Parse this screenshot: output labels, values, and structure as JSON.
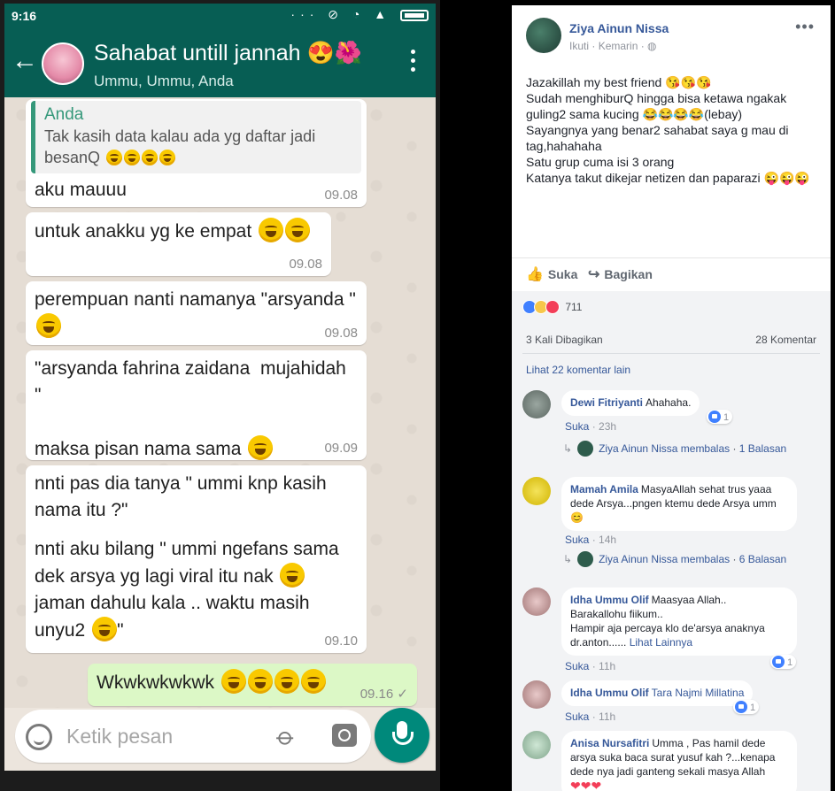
{
  "whatsapp": {
    "status_time": "9:16",
    "status_icons": "··· ⊘ ◔ ▲",
    "back_glyph": "←",
    "chat_title": "Sahabat untill jannah 😍🌺",
    "chat_subtitle": "Ummu, Ummu, Anda",
    "messages": [
      {
        "quote_author": "Anda",
        "quote_text": "Tak kasih data kalau ada yg daftar jadi besanQ",
        "text": "aku mauuu",
        "time": "09.08"
      },
      {
        "text": "untuk anakku yg ke empat",
        "time": "09.08"
      },
      {
        "text": "perempuan nanti namanya \"arsyanda \"",
        "time": "09.08"
      },
      {
        "text": "\"arsyanda fahrina zaidana  mujahidah \"\n\nmaksa pisan nama sama",
        "time": "09.09"
      },
      {
        "text1": "nnti pas dia tanya \" ummi knp kasih nama itu ?\"",
        "text2": "nnti aku bilang \" ummi ngefans sama dek arsya yg lagi viral itu nak",
        "text3": "jaman dahulu kala .. waktu masih unyu2",
        "text4": "\"",
        "time": "09.10"
      },
      {
        "text": "Wkwkwkwkwk",
        "time": "09.16",
        "tick": "✓",
        "outgoing": true
      }
    ],
    "composer_placeholder": "Ketik pesan"
  },
  "facebook": {
    "author": "Ziya Ainun Nissa",
    "follow": "Ikuti",
    "time": "Kemarin",
    "privacy_icon": "globe-icon",
    "more": "•••",
    "post_lines": [
      "Jazakillah my best friend 😘😘😘",
      "Sudah menghiburQ hingga bisa ketawa ngakak guling2 sama kucing 😂😂😂😂(lebay)",
      "Sayangnya yang benar2 sahabat saya g mau di tag,hahahaha",
      "Satu grup cuma isi 3 orang",
      "Katanya takut dikejar netizen dan paparazi 😜😜😜"
    ],
    "like_label": "Suka",
    "share_label": "Bagikan",
    "reaction_count": "711",
    "shares_text": "3 Kali Dibagikan",
    "comments_text": "28 Komentar",
    "more_comments": "Lihat 22 komentar lain",
    "comments": [
      {
        "name": "Dewi Fitriyanti",
        "text": "Ahahaha.",
        "likes": "1",
        "action": "Suka",
        "age": "23h",
        "reply_name": "Ziya Ainun Nissa membalas",
        "reply_count": "1 Balasan"
      },
      {
        "name": "Mamah Amila",
        "text": "MasyaAllah sehat trus yaaa dede Arsya...pngen ktemu dede Arsya umm😊",
        "action": "Suka",
        "age": "14h",
        "reply_name": "Ziya Ainun Nissa membalas",
        "reply_count": "6 Balasan"
      },
      {
        "name": "Idha Ummu Olif",
        "text1": "Maasyaa Allah..",
        "text2": "Barakallohu fiikum..",
        "text3": "Hampir aja percaya klo de'arsya anaknya dr.anton......",
        "see_more": "Lihat Lainnya",
        "likes": "1",
        "action": "Suka",
        "age": "11h"
      },
      {
        "name": "Idha Ummu Olif",
        "text": "Tara Najmi Millatina",
        "likes": "1",
        "action": "Suka",
        "age": "11h"
      },
      {
        "name": "Anisa Nursafitri",
        "text": "Umma , Pas hamil dede arsya suka baca surat yusuf kah ?...kenapa dede nya jadi ganteng sekali masya Allah",
        "hearts": "❤❤❤"
      }
    ]
  },
  "colors": {
    "wa_header": "#075e54",
    "wa_out_bubble": "#dcf8c6",
    "fb_link": "#365899",
    "fb_bg": "#f2f3f5"
  }
}
